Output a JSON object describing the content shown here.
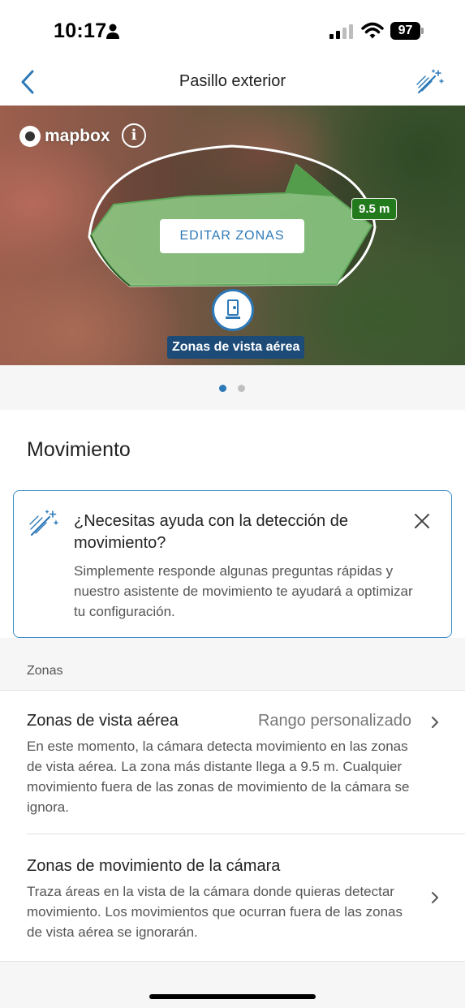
{
  "status_bar": {
    "time": "10:17",
    "battery": "97"
  },
  "nav": {
    "title": "Pasillo exterior"
  },
  "map": {
    "brand": "mapbox",
    "info_glyph": "i",
    "distance": "9.5 m",
    "edit_button": "EDITAR ZONAS",
    "aerial_label": "Zonas de vista aérea",
    "zone_color": "#7fc07a"
  },
  "pager": {
    "pages": 2,
    "active": 1
  },
  "section": {
    "title": "Movimiento"
  },
  "help_card": {
    "title": "¿Necesitas ayuda con la detección de movimiento?",
    "body": "Simplemente responde algunas preguntas rápidas y nuestro asistente de movimiento te ayudará a optimizar tu configuración."
  },
  "zones": {
    "header": "Zonas",
    "items": [
      {
        "title": "Zonas de vista aérea",
        "value": "Rango personalizado",
        "description": "En este momento, la cámara detecta movimiento en las zonas de vista aérea. La zona más distante llega a 9.5 m. Cualquier movimiento fuera de las zonas de movimiento de la cámara se ignora."
      },
      {
        "title": "Zonas de movimiento de la cámara",
        "value": "",
        "description": "Traza áreas en la vista de la cámara donde quieras detectar movimiento. Los movimientos que ocurran fuera de las zonas de vista aérea se ignorarán."
      }
    ]
  },
  "colors": {
    "accent": "#2d79b8",
    "distance_badge": "#237a1c",
    "label_bg": "#1d4b78"
  },
  "icons": [
    "person-icon",
    "signal-icon",
    "wifi-icon",
    "battery-icon",
    "back-chevron-icon",
    "magic-wand-icon",
    "info-icon",
    "camera-icon",
    "close-icon",
    "chevron-right-icon"
  ]
}
